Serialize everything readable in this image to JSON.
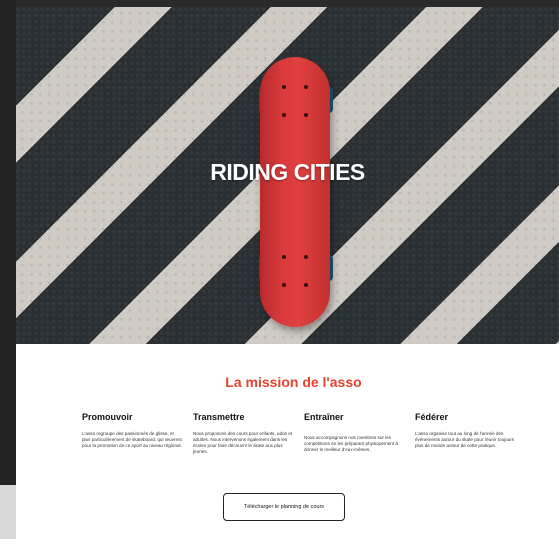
{
  "hero": {
    "title": "RIDING CITIES"
  },
  "mission": {
    "title": "La mission de l'asso",
    "columns": [
      {
        "heading": "Promouvoir",
        "text": "L'asso regroupe des passionnés de glisse, et plus particulièrement de skateboard, qui œuvrent pour la promotion de ce sport au niveau régional."
      },
      {
        "heading": "Transmettre",
        "text": "Nous proposons des cours pour enfants, ados et adultes. Nous intervenons également dans les écoles pour faire découvrir le skate aux plus jeunes."
      },
      {
        "heading": "Entraîner",
        "text": "Nous accompagnons nos membres sur les compétitions en les préparant physiquement à donner le meilleur d'eux-mêmes."
      },
      {
        "heading": "Fédérer",
        "text": "L'asso organise tout au long de l'année des événements autour du skate pour réunir toujours plus de monde autour de cette pratique."
      }
    ]
  },
  "download_button": {
    "label": "Télécharger le planning de cours"
  },
  "colors": {
    "accent": "#e8412f",
    "deck": "#d9393b",
    "wheel": "#1d5a7a"
  }
}
